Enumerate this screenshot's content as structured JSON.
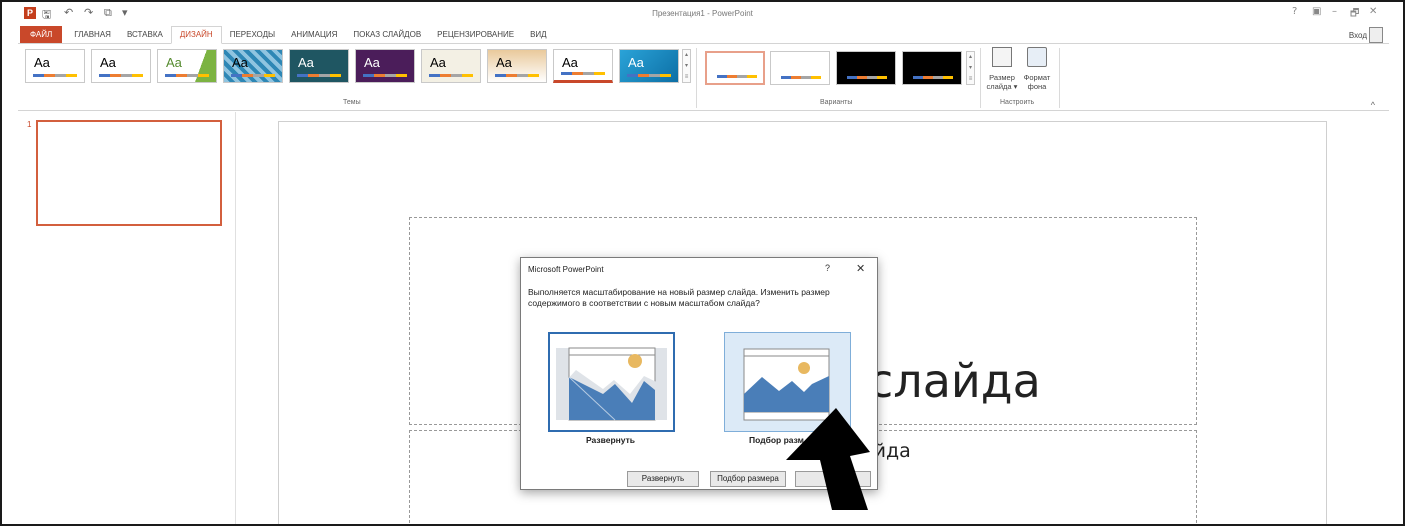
{
  "window": {
    "title": "Презентация1 - PowerPoint",
    "controls": [
      "?",
      "▣",
      "–",
      "🗗",
      "✕"
    ],
    "qat_icons": [
      "save-icon",
      "undo-icon",
      "redo-icon",
      "start-from-beginning-icon"
    ]
  },
  "ribbon": {
    "tabs": [
      {
        "label": "ФАЙЛ",
        "kind": "file"
      },
      {
        "label": "ГЛАВНАЯ"
      },
      {
        "label": "ВСТАВКА"
      },
      {
        "label": "ДИЗАЙН",
        "active": true
      },
      {
        "label": "ПЕРЕХОДЫ"
      },
      {
        "label": "АНИМАЦИЯ"
      },
      {
        "label": "ПОКАЗ СЛАЙДОВ"
      },
      {
        "label": "РЕЦЕНЗИРОВАНИЕ"
      },
      {
        "label": "ВИД"
      }
    ],
    "login": "Вход",
    "themes_group": "Темы",
    "variants_group": "Варианты",
    "customize_group": "Настроить",
    "theme_text": "Aa",
    "slide_size_label": "Размер слайда ▾",
    "format_bg_label": "Формат фона",
    "collapse": "^"
  },
  "slide_panel": {
    "slide_number": "1"
  },
  "slide": {
    "title_fragment": "слайда",
    "subtitle_fragment": "айда"
  },
  "dialog": {
    "title": "Microsoft PowerPoint",
    "help": "?",
    "close": "✕",
    "message": "Выполняется масштабирование на новый размер слайда. Изменить размер содержимого в соответствии с новым масштабом слайда?",
    "option_maximize": "Развернуть",
    "option_ensure_fit": "Подбор разм",
    "button_maximize": "Развернуть",
    "button_ensure_fit": "Подбор размера"
  }
}
